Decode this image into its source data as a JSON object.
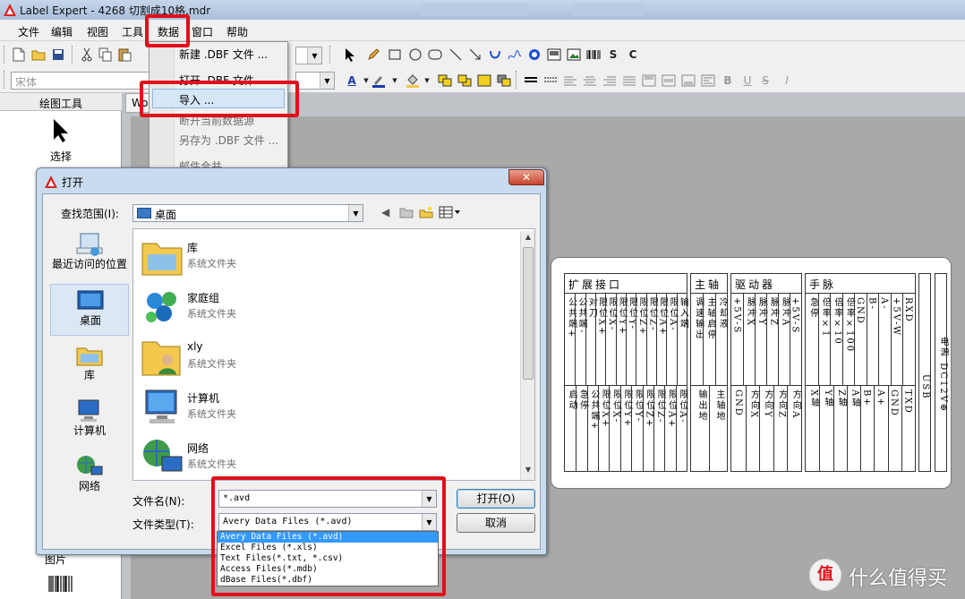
{
  "window": {
    "title": "Label Expert - 4268 切割成10格.mdr",
    "colors": {
      "titlebar": "#a9c0dc",
      "annotation": "#e0101a",
      "selection": "#3399ff"
    }
  },
  "menubar": {
    "items": [
      "文件",
      "编辑",
      "视图",
      "工具",
      "数据",
      "窗口",
      "帮助"
    ]
  },
  "data_menu": {
    "items": [
      {
        "label": "新建 .DBF 文件 ...",
        "enabled": true
      },
      {
        "label": "打开 .DBF 文件",
        "enabled": true
      },
      {
        "label": "导入 ...",
        "enabled": true,
        "highlighted": true
      },
      {
        "label": "断开当前数据源",
        "enabled": false
      },
      {
        "label": "另存为 .DBF 文件 ...",
        "enabled": false
      },
      {
        "label": "邮件合并",
        "enabled": false
      }
    ]
  },
  "toolbar": {
    "font_name": "宋体",
    "draw_tools": [
      "pointer-icon",
      "pencil-icon",
      "rectangle-icon",
      "ellipse-icon",
      "rounded-rect-icon",
      "line-icon",
      "arrow-icon",
      "curve-icon",
      "freehand-icon",
      "circle-arrow-icon",
      "image-icon",
      "picture-icon",
      "barcode-icon"
    ],
    "symbol_S": "S",
    "symbol_C": "C",
    "format_B": "B",
    "format_U": "U",
    "format_S": "S",
    "format_I": "I"
  },
  "tool_panel": {
    "header": "绘图工具",
    "select_label": "选择",
    "bottom_label": "图片"
  },
  "document_tab": {
    "label": "Wo"
  },
  "label_preview": {
    "groups": [
      {
        "title": "扩展接口",
        "top": [
          "公共端+",
          "公共端-",
          "对刀",
          "限位X+",
          "限位X-",
          "限位Y+",
          "限位Y-",
          "限位Z+",
          "限位Z-",
          "限位A+",
          "限位A-",
          "输入端"
        ],
        "bottom": [
          "启动",
          "急停",
          "公共端+",
          "限位X+",
          "限位X-",
          "限位Y+",
          "限位Y-",
          "限位Z+",
          "限位Z-",
          "限位A+",
          "限位A-"
        ]
      },
      {
        "title": "主轴",
        "top": [
          "调速输出",
          "主轴启停",
          "冷却液"
        ],
        "bottom": [
          "输出地",
          "主轴地"
        ]
      },
      {
        "title": "驱动器",
        "top": [
          "+5V-S",
          "脉冲X",
          "脉冲Y",
          "脉冲Z",
          "脉冲A",
          "+5V-S"
        ],
        "bottom": [
          "GND",
          "方向X",
          "方向Y",
          "方向Z",
          "方向A"
        ]
      },
      {
        "title": "手脉",
        "top": [
          "急停",
          "倍率×1",
          "倍率×10",
          "倍率×100",
          "GND",
          "B-",
          "A-",
          "+5V-W",
          "RXD"
        ],
        "bottom": [
          "X轴",
          "Y轴",
          "Z轴",
          "A轴",
          "B+",
          "A+",
          "GND",
          "TXD"
        ]
      }
    ],
    "usb": "USB",
    "power": "电源 DC12V⊕"
  },
  "open_dialog": {
    "title": "打开",
    "close_label": "✕",
    "lookin_label": "查找范围(I):",
    "lookin_value": "桌面",
    "places": [
      {
        "label": "最近访问的位置",
        "icon": "recent-places-icon"
      },
      {
        "label": "桌面",
        "icon": "desktop-icon",
        "selected": true
      },
      {
        "label": "库",
        "icon": "libraries-icon"
      },
      {
        "label": "计算机",
        "icon": "computer-icon"
      },
      {
        "label": "网络",
        "icon": "network-icon"
      }
    ],
    "files": [
      {
        "name": "库",
        "type": "系统文件夹",
        "icon": "libraries-folder-icon"
      },
      {
        "name": "家庭组",
        "type": "系统文件夹",
        "icon": "homegroup-icon"
      },
      {
        "name": "xly",
        "type": "系统文件夹",
        "icon": "user-folder-icon"
      },
      {
        "name": "计算机",
        "type": "系统文件夹",
        "icon": "computer-icon"
      },
      {
        "name": "网络",
        "type": "系统文件夹",
        "icon": "network-icon"
      }
    ],
    "filename_label": "文件名(N):",
    "filename_value": "*.avd",
    "filetype_label": "文件类型(T):",
    "filetype_value": "Avery Data Files (*.avd)",
    "filetype_options": [
      "Avery Data Files (*.avd)",
      "Excel Files (*.xls)",
      "Text Files(*.txt, *.csv)",
      "Access Files(*.mdb)",
      "dBase Files(*.dbf)"
    ],
    "selected_option": 0,
    "open_button": "打开(O)",
    "cancel_button": "取消"
  },
  "watermark": {
    "text": "什么值得买",
    "logo": "值"
  }
}
